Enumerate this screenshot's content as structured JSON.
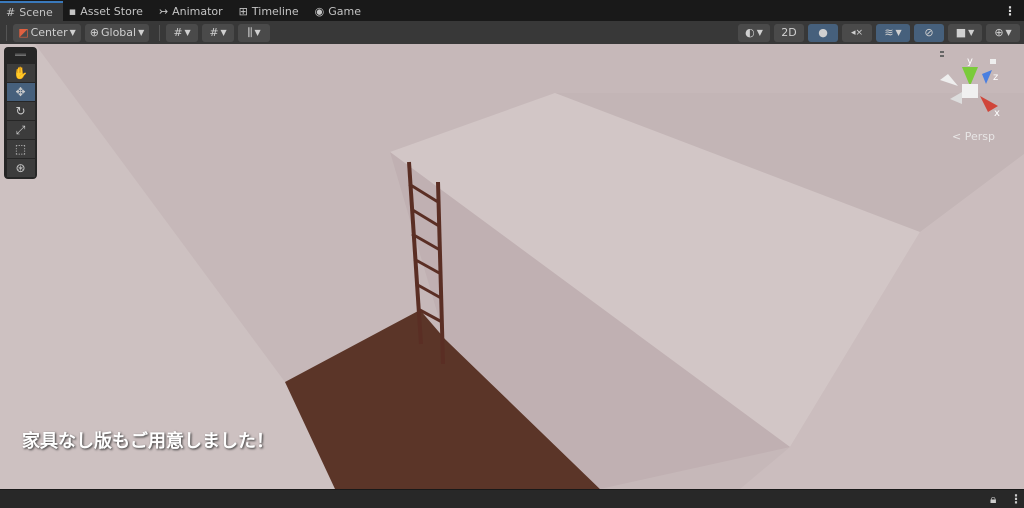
{
  "tabs": [
    {
      "label": "Scene",
      "icon": "grid-icon"
    },
    {
      "label": "Asset Store",
      "icon": "bag-icon"
    },
    {
      "label": "Animator",
      "icon": "animator-icon"
    },
    {
      "label": "Timeline",
      "icon": "film-icon"
    },
    {
      "label": "Game",
      "icon": "gamepad-icon"
    }
  ],
  "toolbar": {
    "pivot": "Center",
    "space": "Global",
    "mode_2d": "2D"
  },
  "tools": [
    "hand",
    "move",
    "rotate",
    "scale",
    "rect",
    "transform"
  ],
  "gizmo": {
    "y": "y",
    "z": "z",
    "x": "x",
    "projection": "Persp"
  },
  "scene": {
    "caption": "家具なし版もご用意しました！"
  },
  "colors": {
    "accent": "#3a79bb",
    "active_btn": "#46607c",
    "floor": "#5a3428",
    "wall": "#cbbebe"
  }
}
